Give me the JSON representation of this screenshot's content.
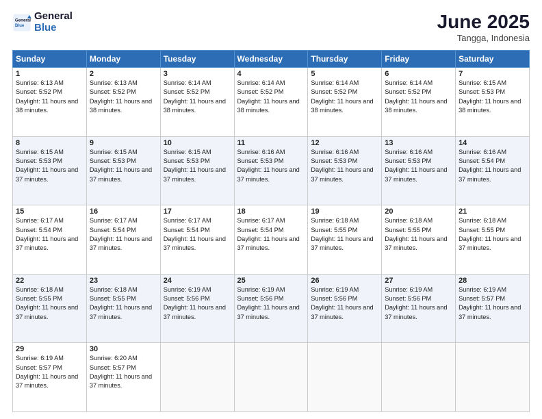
{
  "logo": {
    "line1": "General",
    "line2": "Blue"
  },
  "title": "June 2025",
  "location": "Tangga, Indonesia",
  "header_days": [
    "Sunday",
    "Monday",
    "Tuesday",
    "Wednesday",
    "Thursday",
    "Friday",
    "Saturday"
  ],
  "weeks": [
    [
      {
        "day": "1",
        "sunrise": "6:13 AM",
        "sunset": "5:52 PM",
        "daylight": "11 hours and 38 minutes."
      },
      {
        "day": "2",
        "sunrise": "6:13 AM",
        "sunset": "5:52 PM",
        "daylight": "11 hours and 38 minutes."
      },
      {
        "day": "3",
        "sunrise": "6:14 AM",
        "sunset": "5:52 PM",
        "daylight": "11 hours and 38 minutes."
      },
      {
        "day": "4",
        "sunrise": "6:14 AM",
        "sunset": "5:52 PM",
        "daylight": "11 hours and 38 minutes."
      },
      {
        "day": "5",
        "sunrise": "6:14 AM",
        "sunset": "5:52 PM",
        "daylight": "11 hours and 38 minutes."
      },
      {
        "day": "6",
        "sunrise": "6:14 AM",
        "sunset": "5:52 PM",
        "daylight": "11 hours and 38 minutes."
      },
      {
        "day": "7",
        "sunrise": "6:15 AM",
        "sunset": "5:53 PM",
        "daylight": "11 hours and 38 minutes."
      }
    ],
    [
      {
        "day": "8",
        "sunrise": "6:15 AM",
        "sunset": "5:53 PM",
        "daylight": "11 hours and 37 minutes."
      },
      {
        "day": "9",
        "sunrise": "6:15 AM",
        "sunset": "5:53 PM",
        "daylight": "11 hours and 37 minutes."
      },
      {
        "day": "10",
        "sunrise": "6:15 AM",
        "sunset": "5:53 PM",
        "daylight": "11 hours and 37 minutes."
      },
      {
        "day": "11",
        "sunrise": "6:16 AM",
        "sunset": "5:53 PM",
        "daylight": "11 hours and 37 minutes."
      },
      {
        "day": "12",
        "sunrise": "6:16 AM",
        "sunset": "5:53 PM",
        "daylight": "11 hours and 37 minutes."
      },
      {
        "day": "13",
        "sunrise": "6:16 AM",
        "sunset": "5:53 PM",
        "daylight": "11 hours and 37 minutes."
      },
      {
        "day": "14",
        "sunrise": "6:16 AM",
        "sunset": "5:54 PM",
        "daylight": "11 hours and 37 minutes."
      }
    ],
    [
      {
        "day": "15",
        "sunrise": "6:17 AM",
        "sunset": "5:54 PM",
        "daylight": "11 hours and 37 minutes."
      },
      {
        "day": "16",
        "sunrise": "6:17 AM",
        "sunset": "5:54 PM",
        "daylight": "11 hours and 37 minutes."
      },
      {
        "day": "17",
        "sunrise": "6:17 AM",
        "sunset": "5:54 PM",
        "daylight": "11 hours and 37 minutes."
      },
      {
        "day": "18",
        "sunrise": "6:17 AM",
        "sunset": "5:54 PM",
        "daylight": "11 hours and 37 minutes."
      },
      {
        "day": "19",
        "sunrise": "6:18 AM",
        "sunset": "5:55 PM",
        "daylight": "11 hours and 37 minutes."
      },
      {
        "day": "20",
        "sunrise": "6:18 AM",
        "sunset": "5:55 PM",
        "daylight": "11 hours and 37 minutes."
      },
      {
        "day": "21",
        "sunrise": "6:18 AM",
        "sunset": "5:55 PM",
        "daylight": "11 hours and 37 minutes."
      }
    ],
    [
      {
        "day": "22",
        "sunrise": "6:18 AM",
        "sunset": "5:55 PM",
        "daylight": "11 hours and 37 minutes."
      },
      {
        "day": "23",
        "sunrise": "6:18 AM",
        "sunset": "5:55 PM",
        "daylight": "11 hours and 37 minutes."
      },
      {
        "day": "24",
        "sunrise": "6:19 AM",
        "sunset": "5:56 PM",
        "daylight": "11 hours and 37 minutes."
      },
      {
        "day": "25",
        "sunrise": "6:19 AM",
        "sunset": "5:56 PM",
        "daylight": "11 hours and 37 minutes."
      },
      {
        "day": "26",
        "sunrise": "6:19 AM",
        "sunset": "5:56 PM",
        "daylight": "11 hours and 37 minutes."
      },
      {
        "day": "27",
        "sunrise": "6:19 AM",
        "sunset": "5:56 PM",
        "daylight": "11 hours and 37 minutes."
      },
      {
        "day": "28",
        "sunrise": "6:19 AM",
        "sunset": "5:57 PM",
        "daylight": "11 hours and 37 minutes."
      }
    ],
    [
      {
        "day": "29",
        "sunrise": "6:19 AM",
        "sunset": "5:57 PM",
        "daylight": "11 hours and 37 minutes."
      },
      {
        "day": "30",
        "sunrise": "6:20 AM",
        "sunset": "5:57 PM",
        "daylight": "11 hours and 37 minutes."
      },
      null,
      null,
      null,
      null,
      null
    ]
  ]
}
